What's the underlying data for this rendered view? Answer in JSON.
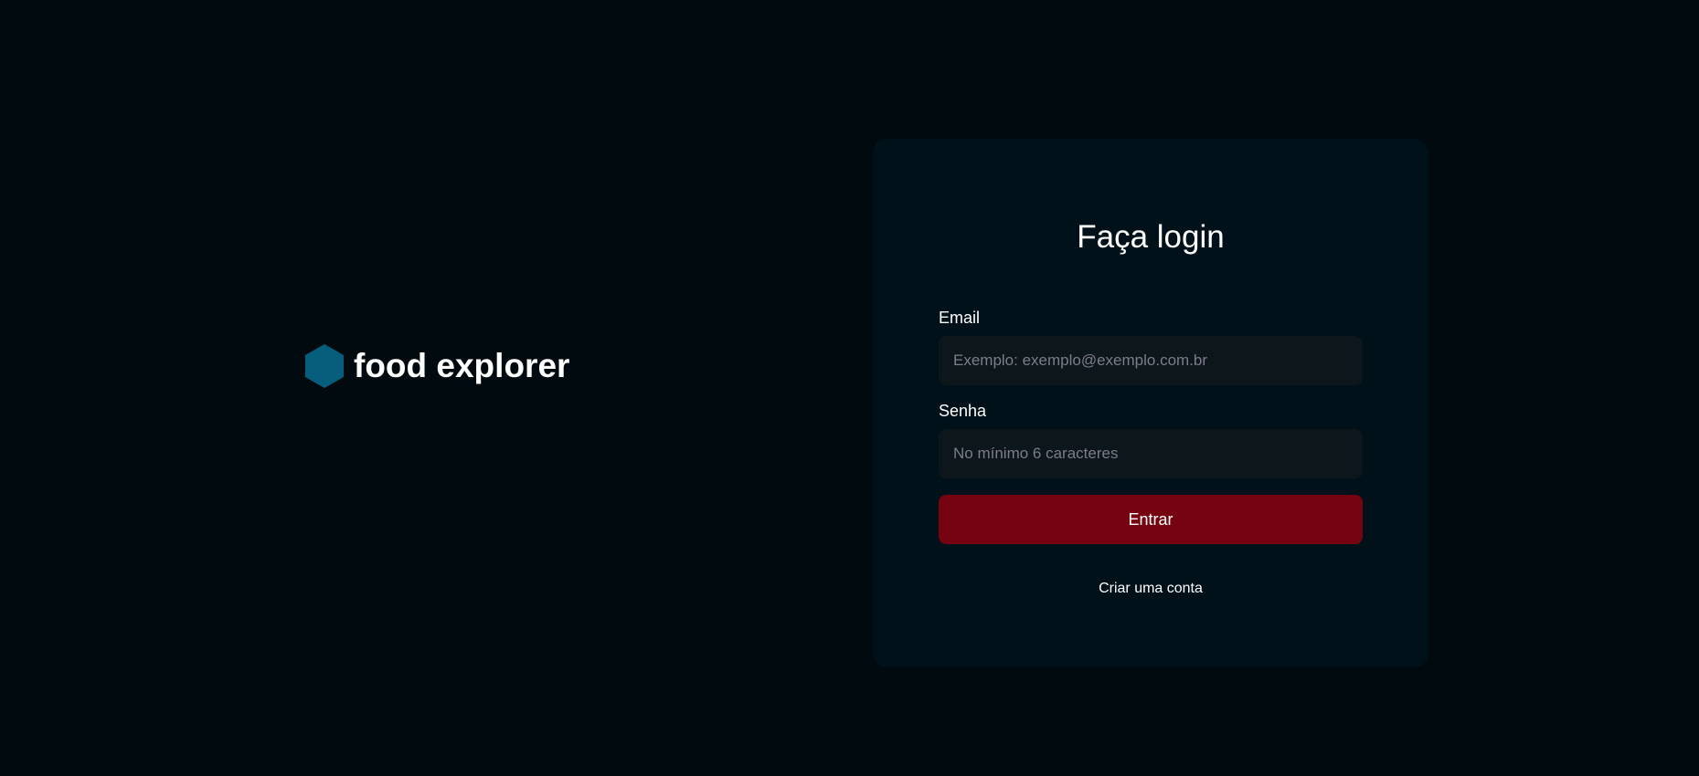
{
  "brand": {
    "name": "food explorer",
    "icon": "hexagon-logo-icon",
    "icon_color": "#065e7c"
  },
  "login": {
    "title": "Faça login",
    "email_label": "Email",
    "email_placeholder": "Exemplo: exemplo@exemplo.com.br",
    "password_label": "Senha",
    "password_placeholder": "No mínimo 6 caracteres",
    "submit_label": "Entrar",
    "signup_link": "Criar uma conta"
  },
  "colors": {
    "background": "#000a0f",
    "card": "#001119",
    "input": "#0d161b",
    "button": "#750310",
    "placeholder": "#7c7c8a"
  }
}
